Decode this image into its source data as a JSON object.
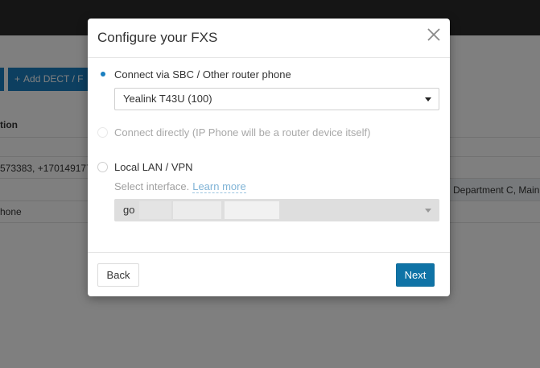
{
  "background": {
    "add_dect_button": "Add DECT / F",
    "table_header": "tion",
    "rows": [
      {
        "phones": "573383, +170149177",
        "department": "Department C, Main"
      },
      {
        "phones": "hone",
        "department": ""
      }
    ]
  },
  "modal": {
    "title": "Configure your FXS",
    "options": [
      {
        "label": "Connect via SBC / Other router phone",
        "checked": true,
        "disabled": false
      },
      {
        "label": "Connect directly (IP Phone will be a router device itself)",
        "checked": false,
        "disabled": true
      },
      {
        "label": "Local LAN / VPN",
        "checked": false,
        "disabled": false
      }
    ],
    "phone_select": {
      "value": "Yealink T43U (100)"
    },
    "interface_hint": "Select interface.",
    "learn_more": "Learn more",
    "interface_select": {
      "value": "go"
    },
    "back_label": "Back",
    "next_label": "Next"
  },
  "colors": {
    "accent": "#0f73a6",
    "radio_checked": "#1a7fc0",
    "header_dark": "#2b2b2b"
  },
  "icons": {
    "close": "close-icon",
    "plus": "plus-icon",
    "caret": "caret-down-icon"
  }
}
